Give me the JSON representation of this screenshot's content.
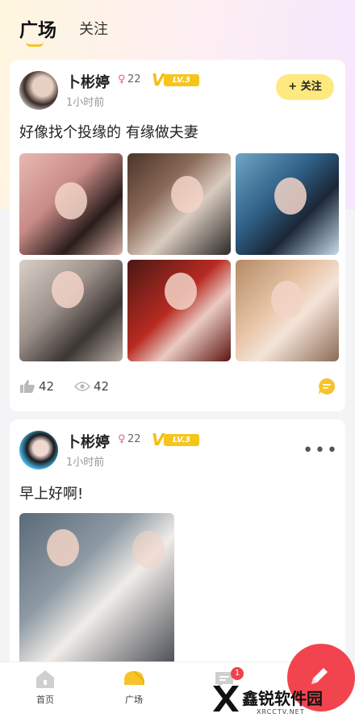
{
  "header": {
    "tabs": [
      {
        "label": "广场",
        "active": true
      },
      {
        "label": "关注",
        "active": false
      }
    ],
    "accent_color": "#f7c32a"
  },
  "posts": [
    {
      "user": {
        "name": "卜彬婷",
        "gender_icon": "female-icon",
        "age": "22",
        "vip_level": "LV.3"
      },
      "time": "1小时前",
      "action": "+ 关注",
      "text": "好像找个投缘的 有缘做夫妻",
      "photo_count": 6,
      "likes": "42",
      "views": "42"
    },
    {
      "user": {
        "name": "卜彬婷",
        "gender_icon": "female-icon",
        "age": "22",
        "vip_level": "LV.3"
      },
      "time": "1小时前",
      "action": "•••",
      "text": "早上好啊!",
      "photo_count": 1
    }
  ],
  "bottom_nav": [
    {
      "label": "首页",
      "icon": "home-icon"
    },
    {
      "label": "广场",
      "icon": "square-icon",
      "active": true
    },
    {
      "label": "",
      "icon": "message-icon",
      "badge": "1"
    }
  ],
  "fab": {
    "icon": "pencil-icon",
    "color": "#f2444e"
  },
  "watermark": {
    "title": "鑫锐软件园",
    "subtitle": "XRCCTV.NET"
  }
}
